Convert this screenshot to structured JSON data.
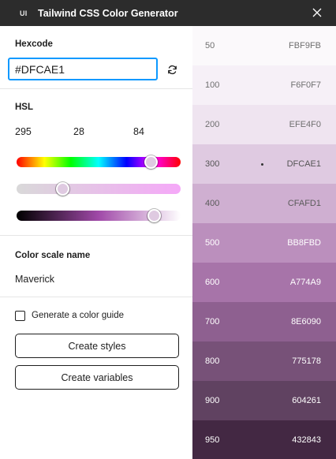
{
  "titlebar": {
    "logo_text": "UI",
    "title": "Tailwind CSS Color Generator",
    "close_icon": "close-icon"
  },
  "hexcode": {
    "label": "Hexcode",
    "value": "#DFCAE1",
    "refresh_icon": "refresh-icon"
  },
  "hsl": {
    "label": "HSL",
    "h": "295",
    "s": "28",
    "l": "84",
    "hue_fraction": 0.82,
    "saturation_fraction": 0.28,
    "lightness_fraction": 0.84,
    "thumb_color": "#DFCAE1"
  },
  "scale": {
    "label": "Color scale name",
    "value": "Maverick"
  },
  "options": {
    "guide_label": "Generate a color guide",
    "guide_checked": false
  },
  "actions": {
    "create_styles": "Create styles",
    "create_variables": "Create variables"
  },
  "swatches": [
    {
      "step": "50",
      "hex": "FBF9FB",
      "color": "#FBF9FB",
      "text": "#6f6f6f",
      "selected": false
    },
    {
      "step": "100",
      "hex": "F6F0F7",
      "color": "#F6F0F7",
      "text": "#6f6f6f",
      "selected": false
    },
    {
      "step": "200",
      "hex": "EFE4F0",
      "color": "#EFE4F0",
      "text": "#6f6f6f",
      "selected": false
    },
    {
      "step": "300",
      "hex": "DFCAE1",
      "color": "#DFCAE1",
      "text": "#555555",
      "selected": true
    },
    {
      "step": "400",
      "hex": "CFAFD1",
      "color": "#CFAFD1",
      "text": "#5a5a5a",
      "selected": false
    },
    {
      "step": "500",
      "hex": "BB8FBD",
      "color": "#BB8FBD",
      "text": "#ffffff",
      "selected": false
    },
    {
      "step": "600",
      "hex": "A774A9",
      "color": "#A774A9",
      "text": "#ffffff",
      "selected": false
    },
    {
      "step": "700",
      "hex": "8E6090",
      "color": "#8E6090",
      "text": "#ffffff",
      "selected": false
    },
    {
      "step": "800",
      "hex": "775178",
      "color": "#775178",
      "text": "#ffffff",
      "selected": false
    },
    {
      "step": "900",
      "hex": "604261",
      "color": "#604261",
      "text": "#ffffff",
      "selected": false
    },
    {
      "step": "950",
      "hex": "432843",
      "color": "#432843",
      "text": "#ffffff",
      "selected": false
    }
  ],
  "colors": {
    "accent": "#0D99FF",
    "titlebar_bg": "#2C2C2C"
  }
}
